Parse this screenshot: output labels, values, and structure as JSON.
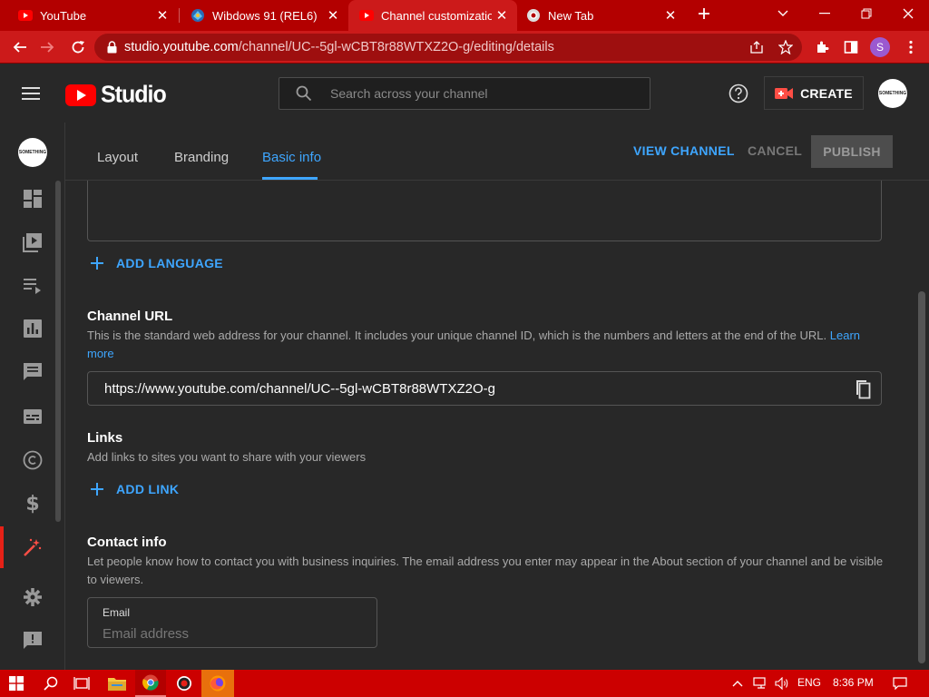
{
  "browser": {
    "tabs": [
      {
        "title": "YouTube",
        "favicon": "youtube-icon"
      },
      {
        "title": "Wibdows 91 (REL6)",
        "favicon": "windows91-icon"
      },
      {
        "title": "Channel customization",
        "favicon": "youtube-icon",
        "active": true
      },
      {
        "title": "New Tab",
        "favicon": "chrome-icon"
      }
    ],
    "url_host": "studio.youtube.com",
    "url_path": "/channel/UC--5gl-wCBT8r88WTXZ2O-g/editing/details",
    "profile_initial": "S"
  },
  "header": {
    "logo_text": "Studio",
    "search_placeholder": "Search across your channel",
    "create_label": "CREATE",
    "avatar_text": "SOMETHING"
  },
  "content_tabs": [
    "Layout",
    "Branding",
    "Basic info"
  ],
  "actions": {
    "view_channel": "VIEW CHANNEL",
    "cancel": "CANCEL",
    "publish": "PUBLISH"
  },
  "add_language": "ADD LANGUAGE",
  "channel_url": {
    "title": "Channel URL",
    "description": "This is the standard web address for your channel. It includes your unique channel ID, which is the numbers and letters at the end of the URL.",
    "learn": "Learn",
    "more": "more",
    "value": "https://www.youtube.com/channel/UC--5gl-wCBT8r88WTXZ2O-g"
  },
  "links": {
    "title": "Links",
    "description": "Add links to sites you want to share with your viewers",
    "add_link": "ADD LINK"
  },
  "contact": {
    "title": "Contact info",
    "description_line1": "Let people know how to contact you with business inquiries. The email address you enter may appear in the About section of your channel and be visible",
    "description_line2": "to viewers.",
    "email_label": "Email",
    "email_placeholder": "Email address"
  },
  "taskbar": {
    "language": "ENG",
    "time": "8:36 PM"
  },
  "colors": {
    "accent_blue": "#3ea6ff",
    "youtube_red": "#ff0000",
    "taskbar_red": "#cc0000",
    "background": "#282828"
  }
}
